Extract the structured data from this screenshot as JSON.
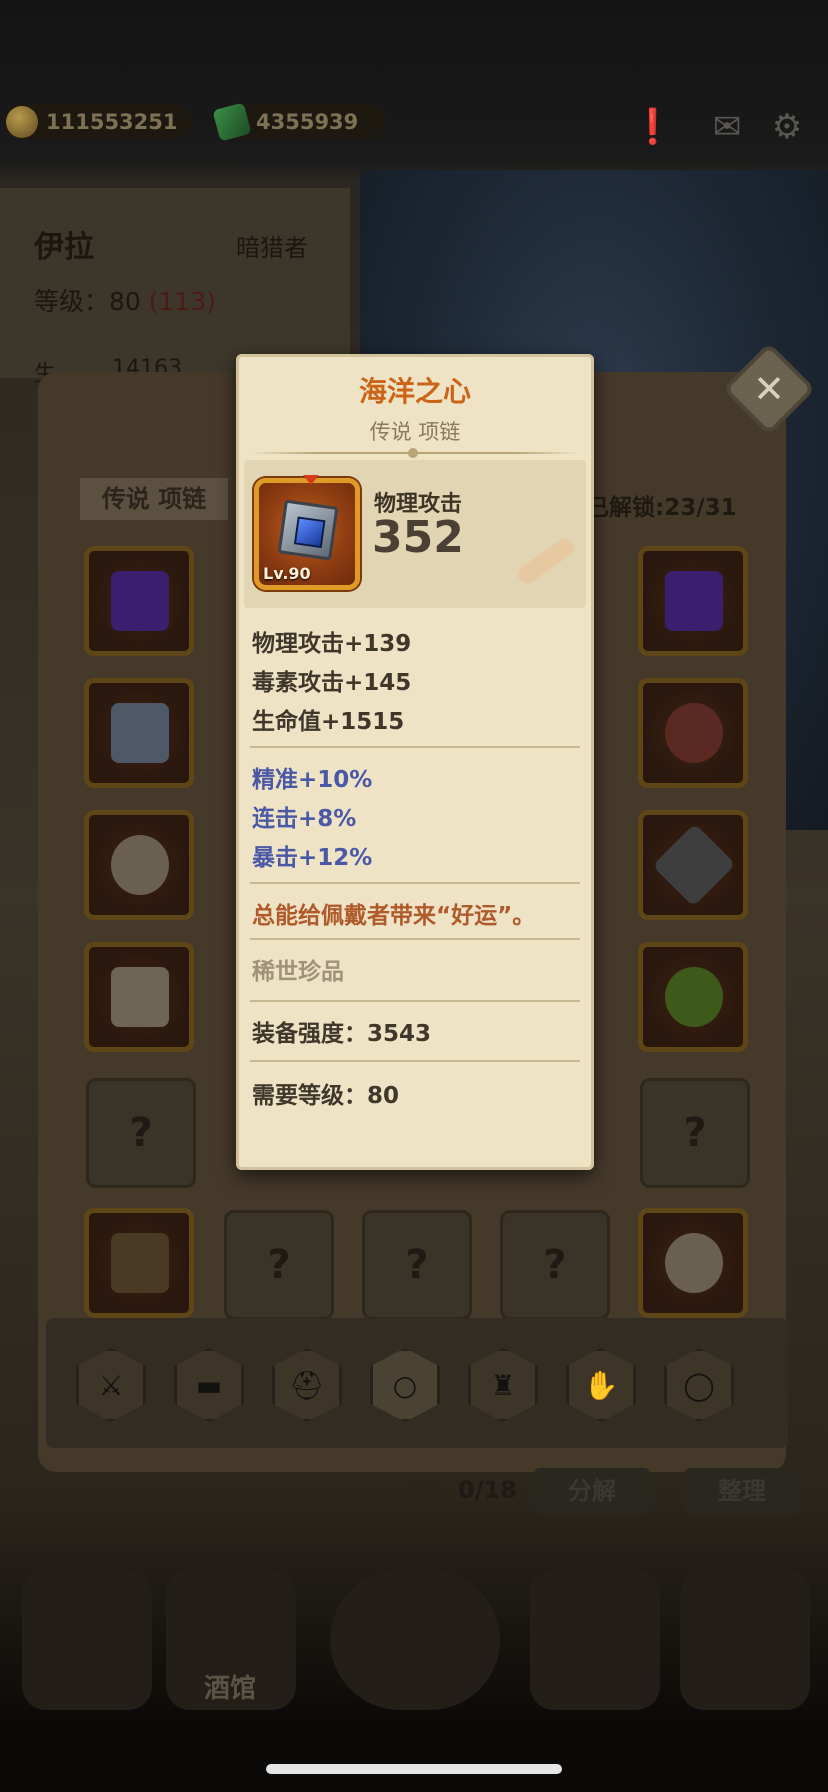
{
  "topbar": {
    "gold_amount": "111553251",
    "gem_amount": "4355939",
    "icons": [
      "alert-icon",
      "mail-icon",
      "gear-icon"
    ]
  },
  "hero": {
    "name": "伊拉",
    "class": "暗猎者",
    "level_label": "等级：80",
    "level_bonus": "(113)",
    "hp_label": "生",
    "hp_value": "14163"
  },
  "panel": {
    "category": "传说 项链",
    "unlocked": "已解锁:23/31",
    "bag_count": "0/18",
    "decompose": "分解",
    "sort": "整理",
    "tavern": "酒馆",
    "empty_slot": "?"
  },
  "item": {
    "name": "海洋之心",
    "subtitle": "传说 项链",
    "level": "Lv.90",
    "main_stat_label": "物理攻击",
    "main_stat_value": "352",
    "base_stats": [
      "物理攻击+139",
      "毒素攻击+145",
      "生命值+1515"
    ],
    "bonus_stats": [
      "精准+10%",
      "连击+8%",
      "暴击+12%"
    ],
    "flavor": "总能给佩戴者带来“好运”。",
    "rarity": "稀世珍品",
    "power": "装备强度：3543",
    "required_level": "需要等级：80"
  },
  "colors": {
    "title": "#cc6418",
    "bonus": "#4a58a6",
    "flavor": "#b05a2c",
    "card_bg": "#efe3c6"
  }
}
